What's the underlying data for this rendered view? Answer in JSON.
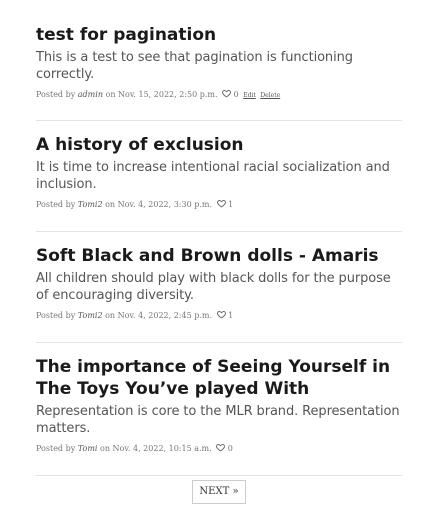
{
  "posts": [
    {
      "title": "test for pagination",
      "excerpt": "This is a test to see that pagination is functioning correctly.",
      "posted_by": "Posted by",
      "author": "admin",
      "on": "on",
      "date": "Nov. 15, 2022, 2:50 p.m.",
      "likes": "0",
      "edit_label": "Edit",
      "delete_label": "Delete"
    },
    {
      "title": "A history of exclusion",
      "excerpt": "It is time to increase intentional racial socialization and inclusion.",
      "posted_by": "Posted by",
      "author": "Tomi2",
      "on": "on",
      "date": "Nov. 4, 2022, 3:30 p.m.",
      "likes": "1"
    },
    {
      "title": "Soft Black and Brown dolls - Amaris",
      "excerpt": "All children should play with black dolls for the purpose of encouraging diversity.",
      "posted_by": "Posted by",
      "author": "Tomi2",
      "on": "on",
      "date": "Nov. 4, 2022, 2:45 p.m.",
      "likes": "1"
    },
    {
      "title": "The importance of Seeing Yourself in The Toys You’ve played With",
      "excerpt": "Representation is core to the MLR brand. Representation matters.",
      "posted_by": "Posted by",
      "author": "Tomi",
      "on": "on",
      "date": "Nov. 4, 2022, 10:15 a.m.",
      "likes": "0"
    }
  ],
  "pagination": {
    "next_label": "NEXT »"
  },
  "icons": {
    "like": "heart-icon"
  }
}
